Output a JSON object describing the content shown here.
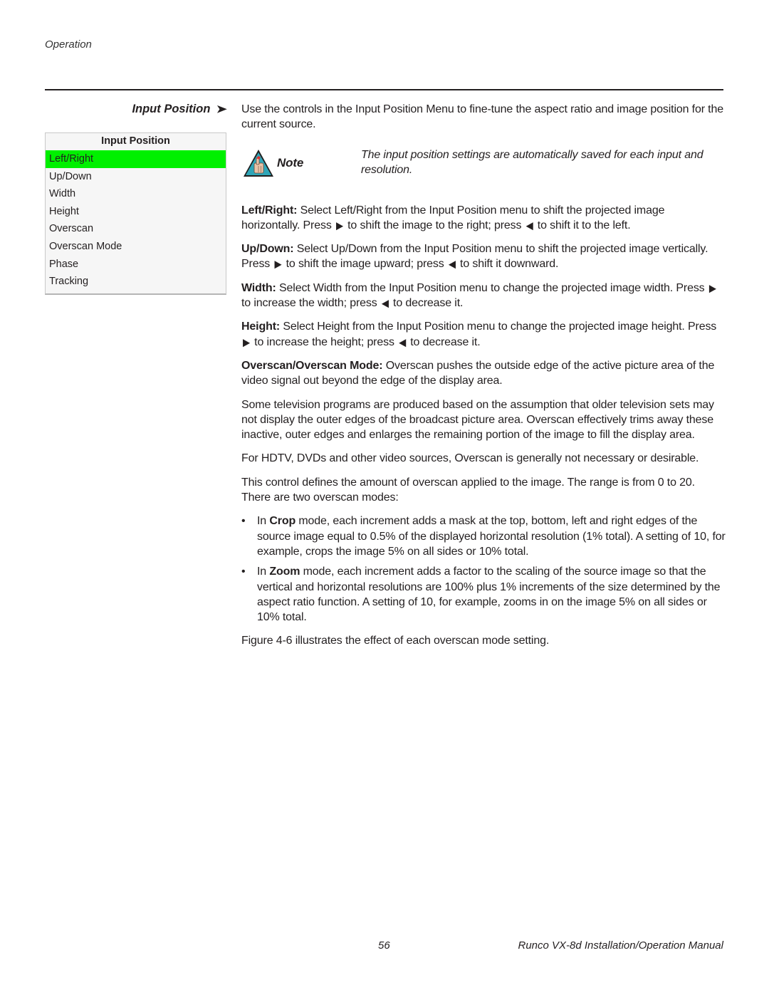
{
  "header": {
    "section": "Operation"
  },
  "side_heading": {
    "title": "Input Position",
    "arrow_icon": "➤"
  },
  "menu": {
    "title": "Input Position",
    "selected_color": "#00f000",
    "items": [
      {
        "label": "Left/Right",
        "selected": true
      },
      {
        "label": "Up/Down",
        "selected": false
      },
      {
        "label": "Width",
        "selected": false
      },
      {
        "label": "Height",
        "selected": false
      },
      {
        "label": "Overscan",
        "selected": false
      },
      {
        "label": "Overscan Mode",
        "selected": false
      },
      {
        "label": "Phase",
        "selected": false
      },
      {
        "label": "Tracking",
        "selected": false
      }
    ]
  },
  "intro": "Use the controls in the Input Position Menu to fine-tune the aspect ratio and image position for the current source.",
  "note": {
    "icon": "note-hand-pointer-warning-icon",
    "label": "Note",
    "text": "The input position settings are automatically saved for each input and resolution."
  },
  "icons": {
    "right_arrow": "▶",
    "left_arrow": "◀",
    "bullet": "•"
  },
  "paragraphs": {
    "left_right": {
      "term": "Left/Right:",
      "t1": " Select Left/Right from the Input Position menu to shift the projected image horizontally. Press ",
      "t2": " to shift the image to the right; press ",
      "t3": " to shift it to the left."
    },
    "up_down": {
      "term": "Up/Down:",
      "t1": " Select Up/Down from the Input Position menu to shift the projected image vertically. Press ",
      "t2": " to shift the image upward; press ",
      "t3": " to shift it downward."
    },
    "width": {
      "term": "Width:",
      "t1": " Select Width from the Input Position menu to change the projected image width. Press ",
      "t2": " to increase the width; press ",
      "t3": " to decrease it."
    },
    "height": {
      "term": "Height:",
      "t1": " Select Height from the Input Position menu to change the projected image height. Press ",
      "t2": " to increase the height; press ",
      "t3": " to decrease it."
    },
    "overscan": {
      "term": "Overscan/Overscan Mode:",
      "t1": " Overscan pushes the outside edge of the active picture area of the video signal out beyond the edge of the display area."
    },
    "some_tv": "Some television programs are produced based on the assumption that older television sets may not display the outer edges of the broadcast picture area. Overscan effectively trims away these inactive, outer edges and enlarges the remaining portion of the image to fill the display area.",
    "hdtv": "For HDTV, DVDs and other video sources, Overscan is generally not necessary or desirable.",
    "range": "This control defines the amount of overscan applied to the image. The range is from 0 to 20. There are two overscan modes:",
    "figure_ref": "Figure 4-6 illustrates the effect of each overscan mode setting."
  },
  "bullets": [
    {
      "pre": "In ",
      "term": "Crop",
      "post": " mode, each increment adds a mask at the top, bottom, left and right edges of the source image equal to 0.5% of the displayed horizontal resolution (1% total). A setting of 10, for example, crops the image 5% on all sides or 10% total."
    },
    {
      "pre": "In ",
      "term": "Zoom",
      "post": " mode, each increment adds a factor to the scaling of the source image so that the vertical and horizontal resolutions are 100% plus 1% increments of the size determined by the aspect ratio function. A setting of 10, for example, zooms in on the image 5% on all sides or 10% total."
    }
  ],
  "footer": {
    "page_number": "56",
    "manual_title": "Runco VX-8d Installation/Operation Manual"
  }
}
